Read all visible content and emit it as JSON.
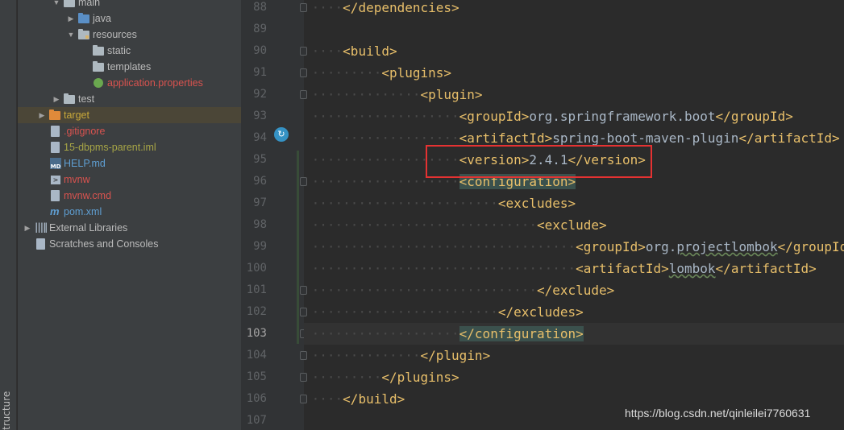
{
  "sidebar": {
    "structure_label": "tructure"
  },
  "project_tree": {
    "items": [
      {
        "label": "main",
        "icon": "folder-icon",
        "indent": 0,
        "arrow": "expanded"
      },
      {
        "label": "java",
        "icon": "folder-blue-icon",
        "indent": 1,
        "arrow": "collapsed"
      },
      {
        "label": "resources",
        "icon": "resources-folder-icon",
        "indent": 1,
        "arrow": "expanded"
      },
      {
        "label": "static",
        "icon": "folder-icon",
        "indent": 2,
        "arrow": "none"
      },
      {
        "label": "templates",
        "icon": "folder-icon",
        "indent": 2,
        "arrow": "none"
      },
      {
        "label": "application.properties",
        "icon": "spring-properties-icon",
        "indent": 2,
        "arrow": "none",
        "color": "#d9534f"
      },
      {
        "label": "test",
        "icon": "folder-icon",
        "indent": 0,
        "arrow": "collapsed"
      },
      {
        "label": "target",
        "icon": "folder-orange-icon",
        "indent": -1,
        "arrow": "collapsed",
        "color": "#c9a93a",
        "selected": true
      },
      {
        "label": ".gitignore",
        "icon": "gitignore-file-icon",
        "indent": -1,
        "arrow": "none",
        "color": "#d9534f"
      },
      {
        "label": "15-dbpms-parent.iml",
        "icon": "iml-file-icon",
        "indent": -1,
        "arrow": "none",
        "color": "#a7a546"
      },
      {
        "label": "HELP.md",
        "icon": "markdown-file-icon",
        "indent": -1,
        "arrow": "none",
        "color": "#5f9fd3"
      },
      {
        "label": "mvnw",
        "icon": "script-file-icon",
        "indent": -1,
        "arrow": "none",
        "color": "#d9534f"
      },
      {
        "label": "mvnw.cmd",
        "icon": "cmd-file-icon",
        "indent": -1,
        "arrow": "none",
        "color": "#d9534f"
      },
      {
        "label": "pom.xml",
        "icon": "maven-icon",
        "indent": -1,
        "arrow": "none",
        "color": "#5f9fd3"
      },
      {
        "label": "External Libraries",
        "icon": "libraries-icon",
        "indent": -2,
        "arrow": "collapsed"
      },
      {
        "label": "Scratches and Consoles",
        "icon": "scratches-icon",
        "indent": -2,
        "arrow": "none"
      }
    ]
  },
  "editor": {
    "current_line": "103",
    "lines": [
      {
        "n": "88",
        "level": 1,
        "tokens": [
          {
            "t": "</dependencies>",
            "c": "tag"
          }
        ]
      },
      {
        "n": "89",
        "level": 0,
        "tokens": []
      },
      {
        "n": "90",
        "level": 1,
        "tokens": [
          {
            "t": "<build>",
            "c": "tag"
          }
        ]
      },
      {
        "n": "91",
        "level": 2,
        "tokens": [
          {
            "t": "<plugins>",
            "c": "tag"
          }
        ]
      },
      {
        "n": "92",
        "level": 3,
        "tokens": [
          {
            "t": "<plugin>",
            "c": "tag"
          }
        ]
      },
      {
        "n": "93",
        "level": 4,
        "tokens": [
          {
            "t": "<groupId>",
            "c": "tag"
          },
          {
            "t": "org.springframework.boot",
            "c": "txt"
          },
          {
            "t": "</groupId>",
            "c": "tag"
          }
        ]
      },
      {
        "n": "94",
        "level": 4,
        "tokens": [
          {
            "t": "<artifactId>",
            "c": "tag"
          },
          {
            "t": "spring-boot-maven-plugin",
            "c": "txt"
          },
          {
            "t": "</artifactId>",
            "c": "tag"
          }
        ]
      },
      {
        "n": "95",
        "level": 4,
        "tokens": [
          {
            "t": "<version>",
            "c": "tag"
          },
          {
            "t": "2.4.1",
            "c": "txt"
          },
          {
            "t": "</version>",
            "c": "tag"
          }
        ]
      },
      {
        "n": "96",
        "level": 4,
        "tokens": [
          {
            "t": "<configuration>",
            "c": "tag hl"
          }
        ]
      },
      {
        "n": "97",
        "level": 5,
        "tokens": [
          {
            "t": "<excludes>",
            "c": "tag"
          }
        ]
      },
      {
        "n": "98",
        "level": 6,
        "tokens": [
          {
            "t": "<exclude>",
            "c": "tag"
          }
        ]
      },
      {
        "n": "99",
        "level": 7,
        "tokens": [
          {
            "t": "<groupId>",
            "c": "tag"
          },
          {
            "t": "org.",
            "c": "txt"
          },
          {
            "t": "projectlombok",
            "c": "txt sq"
          },
          {
            "t": "</groupId>",
            "c": "tag"
          }
        ]
      },
      {
        "n": "100",
        "level": 7,
        "tokens": [
          {
            "t": "<artifactId>",
            "c": "tag"
          },
          {
            "t": "lombok",
            "c": "txt sq"
          },
          {
            "t": "</artifactId>",
            "c": "tag"
          }
        ]
      },
      {
        "n": "101",
        "level": 6,
        "tokens": [
          {
            "t": "</exclude>",
            "c": "tag"
          }
        ]
      },
      {
        "n": "102",
        "level": 5,
        "tokens": [
          {
            "t": "</excludes>",
            "c": "tag"
          }
        ]
      },
      {
        "n": "103",
        "level": 4,
        "tokens": [
          {
            "t": "</configuration>",
            "c": "tag hl"
          }
        ]
      },
      {
        "n": "104",
        "level": 3,
        "tokens": [
          {
            "t": "</plugin>",
            "c": "tag"
          }
        ]
      },
      {
        "n": "105",
        "level": 2,
        "tokens": [
          {
            "t": "</plugins>",
            "c": "tag"
          }
        ]
      },
      {
        "n": "106",
        "level": 1,
        "tokens": [
          {
            "t": "</build>",
            "c": "tag"
          }
        ]
      },
      {
        "n": "107",
        "level": 0,
        "tokens": []
      }
    ]
  },
  "watermark": "https://blog.csdn.net/qinleilei7760631"
}
